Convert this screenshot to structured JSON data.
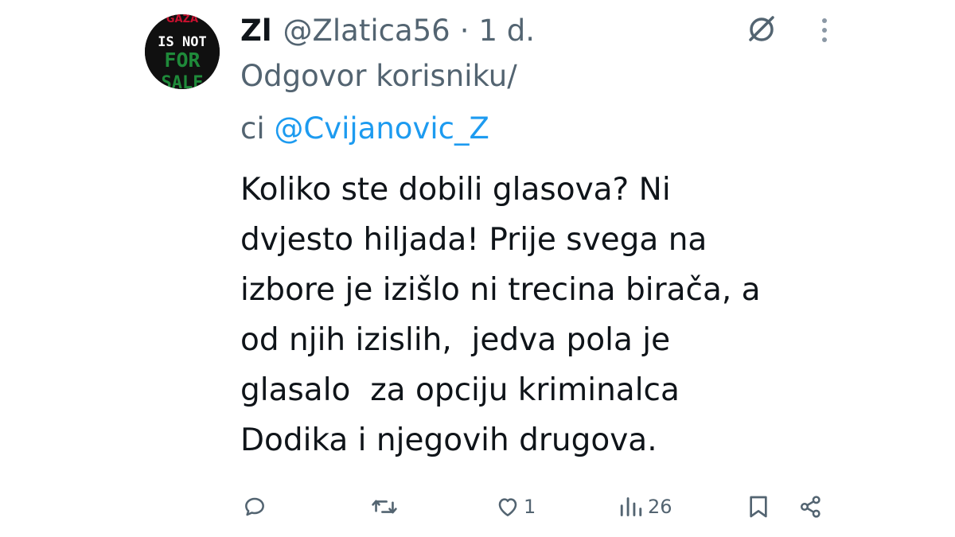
{
  "tweet": {
    "display_name": "Zl",
    "handle": "@Zlatica56",
    "separator": "·",
    "time": "1 d.",
    "reply_prefix_line1": "Odgovor korisniku/",
    "reply_prefix_line2": "ci",
    "reply_mention": "@Cvijanovic_Z",
    "text_lines": [
      "Koliko ste dobili glasova? Ni",
      "dvjesto hiljada! Prije svega na",
      "izbore je izišlo ni trecina birača, a",
      "od njih izislih,  jedva pola je",
      "glasalo  za opciju kriminalca",
      "Dodika i njegovih drugova."
    ],
    "avatar_text": [
      "GAZA",
      "IS NOT",
      "FOR",
      "SALE"
    ]
  },
  "actions": {
    "reply_icon": "reply-icon",
    "retweet_icon": "retweet-icon",
    "like_icon": "like-icon",
    "like_count": "1",
    "views_icon": "views-icon",
    "views_count": "26",
    "bookmark_icon": "bookmark-icon",
    "share_icon": "share-icon"
  },
  "colors": {
    "text": "#0f1419",
    "secondary": "#536471",
    "link": "#1d9bf0"
  }
}
